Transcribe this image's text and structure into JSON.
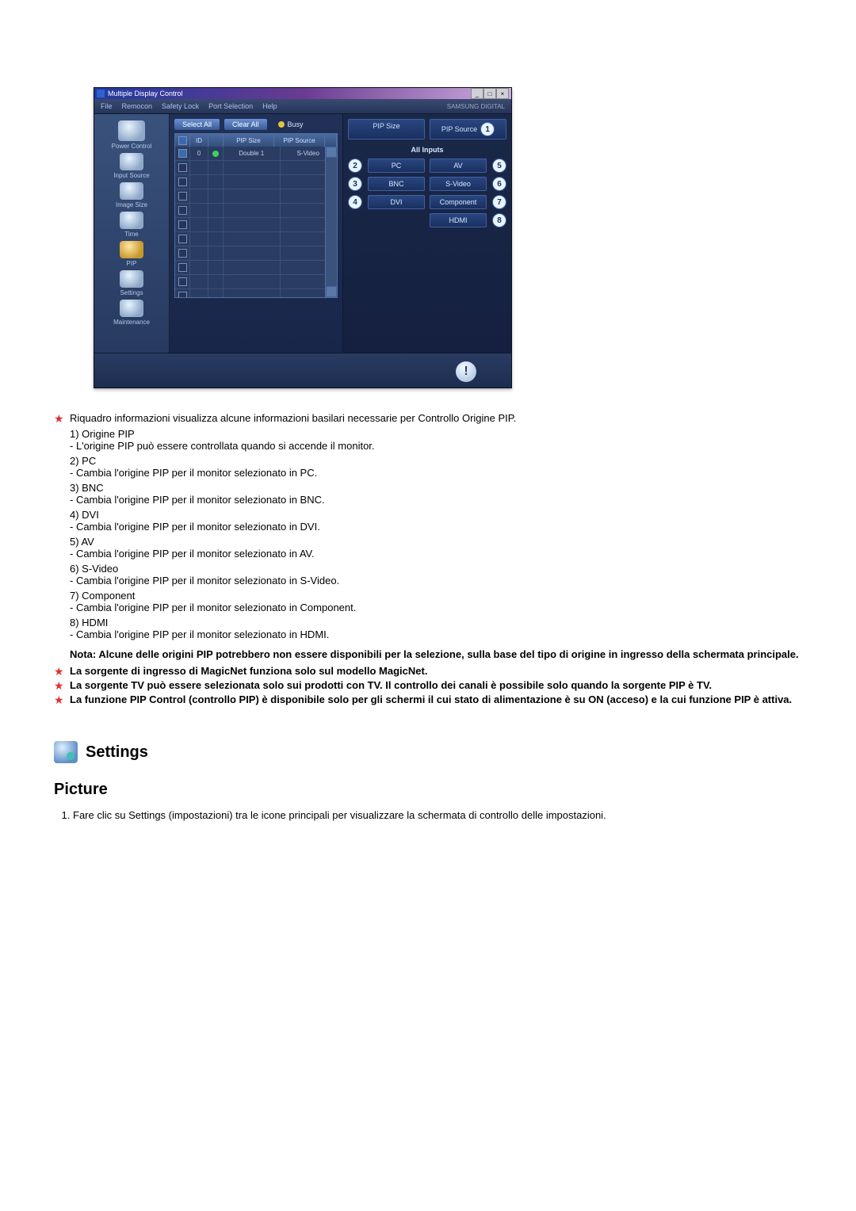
{
  "app": {
    "title": "Multiple Display Control",
    "brand": "SAMSUNG DIGITAL",
    "menu": [
      "File",
      "Remocon",
      "Safety Lock",
      "Port Selection",
      "Help"
    ]
  },
  "sidebar": {
    "items": [
      {
        "label": "Power Control"
      },
      {
        "label": "Input Source"
      },
      {
        "label": "Image Size"
      },
      {
        "label": "Time"
      },
      {
        "label": "PIP"
      },
      {
        "label": "Settings"
      },
      {
        "label": "Maintenance"
      }
    ]
  },
  "toolbar": {
    "select_all": "Select All",
    "clear_all": "Clear All",
    "busy": "Busy"
  },
  "grid": {
    "headers": {
      "id": "ID",
      "pip_size": "PIP Size",
      "pip_source": "PIP Source"
    },
    "row": {
      "id": "0",
      "pip_size": "Double 1",
      "pip_source": "S-Video"
    }
  },
  "rightpanel": {
    "pip_size": "PIP Size",
    "pip_source": "PIP Source",
    "all_inputs": "All Inputs",
    "left": [
      {
        "n": "2",
        "label": "PC"
      },
      {
        "n": "3",
        "label": "BNC"
      },
      {
        "n": "4",
        "label": "DVI"
      }
    ],
    "right": [
      {
        "n": "5",
        "label": "AV"
      },
      {
        "n": "6",
        "label": "S-Video"
      },
      {
        "n": "7",
        "label": "Component"
      },
      {
        "n": "8",
        "label": "HDMI"
      }
    ],
    "num1": "1"
  },
  "doc": {
    "intro_star": "Riquadro informazioni visualizza alcune informazioni basilari necessarie per Controllo Origine PIP.",
    "items": [
      {
        "h": "1) Origine PIP",
        "d": "- L'origine PIP può essere controllata quando si accende il monitor."
      },
      {
        "h": "2) PC",
        "d": "- Cambia l'origine PIP per il monitor selezionato in PC."
      },
      {
        "h": "3) BNC",
        "d": "- Cambia l'origine PIP per il monitor selezionato in BNC."
      },
      {
        "h": "4) DVI",
        "d": "- Cambia l'origine PIP per il monitor selezionato in DVI."
      },
      {
        "h": "5) AV",
        "d": "- Cambia l'origine PIP per il monitor selezionato in AV."
      },
      {
        "h": "6) S-Video",
        "d": "- Cambia l'origine PIP per il monitor selezionato in S-Video."
      },
      {
        "h": "7) Component",
        "d": "- Cambia l'origine PIP per il monitor selezionato in Component."
      },
      {
        "h": "8) HDMI",
        "d": "- Cambia l'origine PIP per il monitor selezionato in HDMI."
      }
    ],
    "note": "Nota: Alcune delle origini PIP potrebbero non essere disponibili per la selezione, sulla base del tipo di origine in ingresso della schermata principale.",
    "star_notes": [
      "La sorgente di ingresso di MagicNet funziona solo sul modello MagicNet.",
      "La sorgente TV può essere selezionata solo sui prodotti con TV. Il controllo dei canali è possibile solo quando la sorgente PIP è TV.",
      "La funzione PIP Control (controllo PIP) è disponibile solo per gli schermi il cui stato di alimentazione è su ON (acceso) e la cui funzione PIP è attiva."
    ],
    "settings_title": "Settings",
    "picture_title": "Picture",
    "picture_step": "Fare clic su Settings (impostazioni) tra le icone principali per visualizzare la schermata di controllo delle impostazioni."
  }
}
